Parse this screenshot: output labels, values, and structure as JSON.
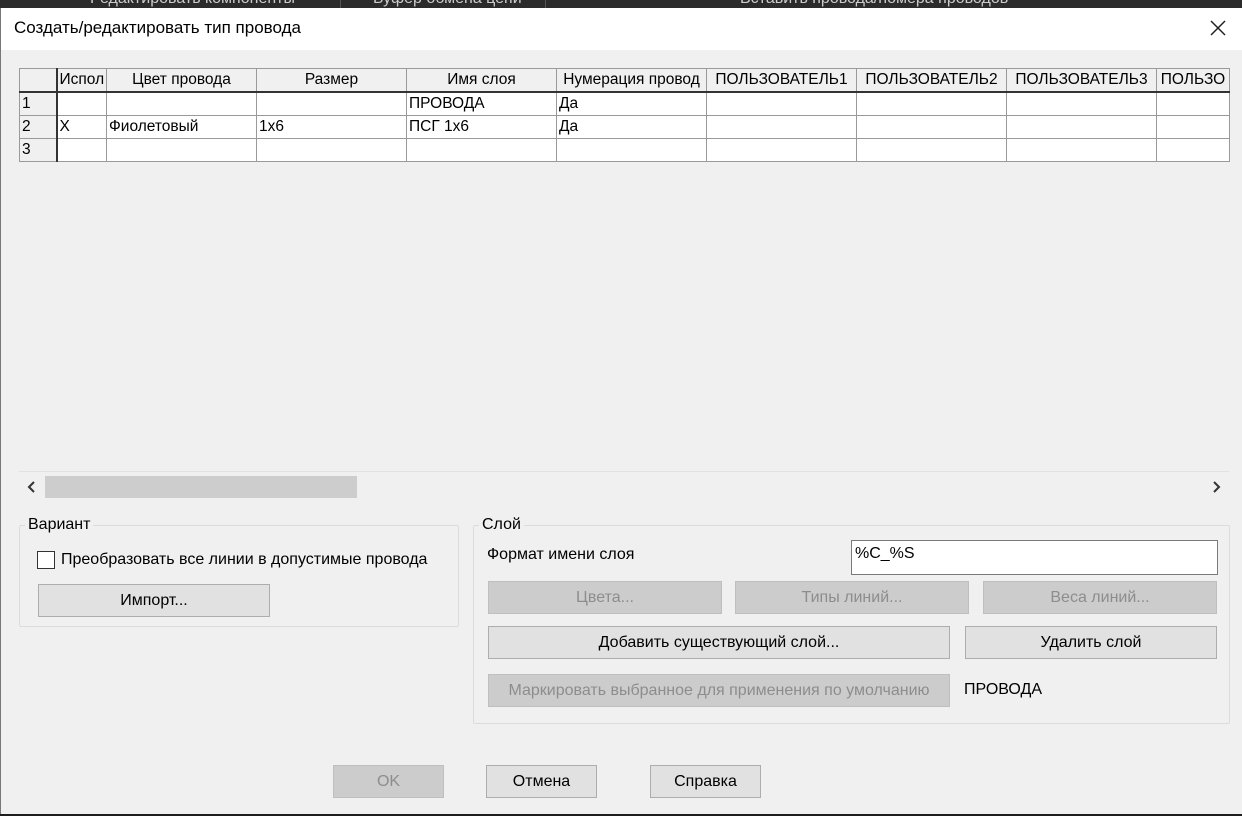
{
  "background": {
    "items": [
      "Редактировать компоненты",
      "Буфер обмена цепи",
      "Вставить провода/номера проводов"
    ]
  },
  "dialog": {
    "title": "Создать/редактировать тип провода",
    "close_icon": "close-icon"
  },
  "grid": {
    "columns": [
      "",
      "Испол",
      "Цвет провода",
      "Размер",
      "Имя слоя",
      "Нумерация провод",
      "ПОЛЬЗОВАТЕЛЬ1",
      "ПОЛЬЗОВАТЕЛЬ2",
      "ПОЛЬЗОВАТЕЛЬ3",
      "ПОЛЬЗО"
    ],
    "rows": [
      [
        "1",
        "",
        "",
        "",
        "ПРОВОДА",
        "Да",
        "",
        "",
        "",
        ""
      ],
      [
        "2",
        "X",
        "Фиолетовый",
        "1x6",
        "ПСГ 1x6",
        "Да",
        "",
        "",
        "",
        ""
      ],
      [
        "3",
        "",
        "",
        "",
        "",
        "",
        "",
        "",
        "",
        ""
      ]
    ]
  },
  "variant": {
    "label": "Вариант",
    "convert_checkbox_label": "Преобразовать все линии в допустимые провода",
    "convert_checked": false,
    "import_button": "Импорт..."
  },
  "layer": {
    "label": "Слой",
    "format_label": "Формат имени слоя",
    "format_value": "%C_%S",
    "colors_button": "Цвета...",
    "linetypes_button": "Типы линий...",
    "lineweights_button": "Веса линий...",
    "add_existing_button": "Добавить существующий слой...",
    "delete_button": "Удалить слой",
    "mark_default_button": "Маркировать выбранное для применения по умолчанию",
    "default_layer_value": "ПРОВОДА"
  },
  "footer": {
    "ok_button": "OK",
    "cancel_button": "Отмена",
    "help_button": "Справка"
  },
  "colors": {
    "dialog_bg": "#f0f0f0",
    "titlebar_bg": "#ffffff",
    "disabled_button": "#cccccc",
    "button": "#e1e1e1"
  }
}
